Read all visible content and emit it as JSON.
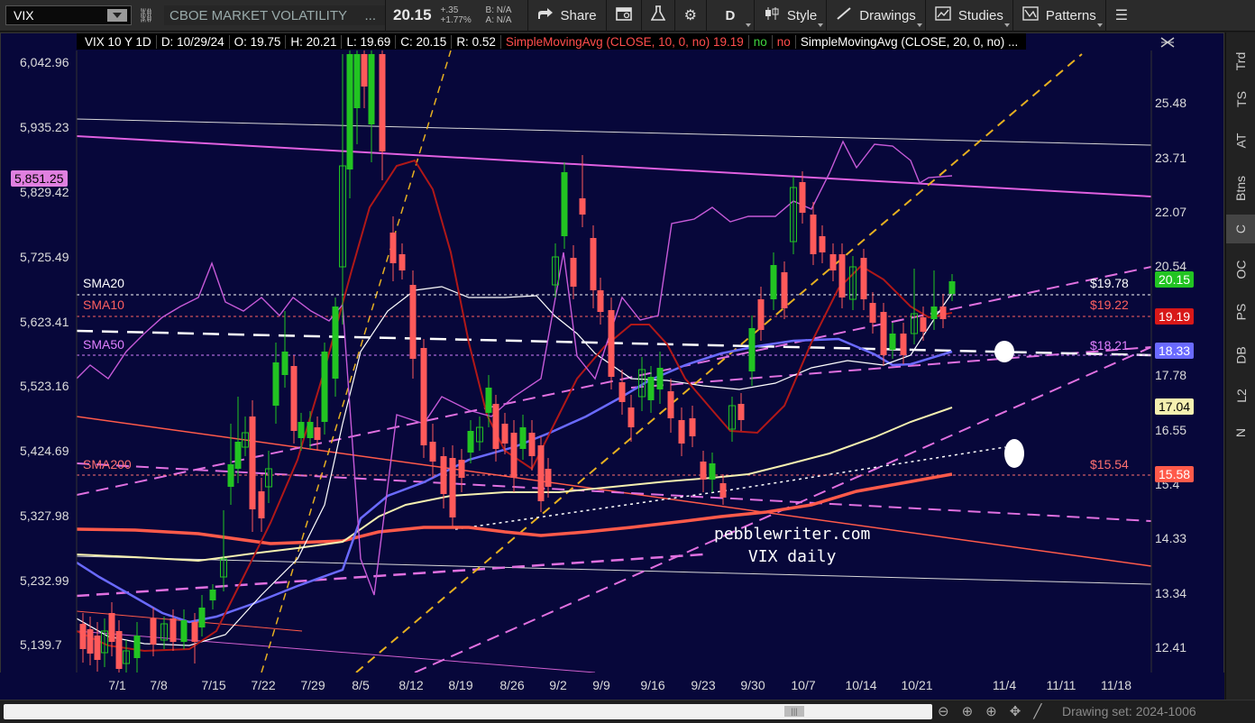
{
  "toolbar": {
    "symbol": "VIX",
    "description": "CBOE MARKET VOLATILITY",
    "description_more": "...",
    "last_price": "20.15",
    "net_change": "+.35",
    "pct_change": "+1.77%",
    "bid": "B: N/A",
    "ask": "A: N/A",
    "share_label": "Share",
    "aggregation": "D",
    "style_label": "Style",
    "drawings_label": "Drawings",
    "studies_label": "Studies",
    "patterns_label": "Patterns",
    "icons": [
      "link-icon",
      "share-icon",
      "calendar-icon",
      "flask-icon",
      "gear-icon",
      "candles-icon",
      "pencil-icon",
      "studies-icon",
      "patterns-icon",
      "menu-icon"
    ]
  },
  "info_bar": {
    "title": "VIX 10 Y 1D",
    "date": "D: 10/29/24",
    "open": "O: 19.75",
    "high": "H: 20.21",
    "low": "L: 19.69",
    "close": "C: 20.15",
    "range": "R: 0.52",
    "sma10_label": "SimpleMovingAvg (CLOSE, 10, 0, no)",
    "sma10_value": "19.19",
    "sma10_no1": "no",
    "sma10_no2": "no",
    "sma20_label": "SimpleMovingAvg (CLOSE, 20, 0, no)",
    "sma20_more": "..."
  },
  "left_axis": [
    "6,042.96",
    "5,935.23",
    "5,829.42",
    "5,725.49",
    "5,623.41",
    "5,523.16",
    "5,424.69",
    "5,327.98",
    "5,232.99",
    "5,139.7"
  ],
  "left_badge": "5,851.25",
  "right_axis": [
    "25.48",
    "23.71",
    "22.07",
    "20.54",
    "17.78",
    "16.55",
    "15.4",
    "14.33",
    "13.34",
    "12.41"
  ],
  "right_badges": {
    "last": "20.15",
    "sma10": "19.19",
    "sma50": "18.33",
    "yellow": "17.04",
    "sma200": "15.58"
  },
  "x_axis": [
    "7/1",
    "7/8",
    "7/15",
    "7/22",
    "7/29",
    "8/5",
    "8/12",
    "8/19",
    "8/26",
    "9/2",
    "9/9",
    "9/16",
    "9/23",
    "9/30",
    "10/7",
    "10/14",
    "10/21",
    "11/4",
    "11/11",
    "11/18"
  ],
  "chart_labels": {
    "sma20": "SMA20",
    "sma10": "SMA10",
    "sma50": "SMA50",
    "sma200": "SMA200",
    "sma20_price": "$19.78",
    "sma10_price": "$19.22",
    "sma50_price": "$18.21",
    "sma200_price": "$15.54"
  },
  "watermark": {
    "line1": "pebblewriter.com",
    "line2": "VIX daily"
  },
  "sidebar_tabs": [
    "Trd",
    "TS",
    "AT",
    "Btns",
    "C",
    "OC",
    "PS",
    "DB",
    "L2",
    "N"
  ],
  "bottom": {
    "drawing_set": "Drawing set: 2024-1006"
  },
  "colors": {
    "chart_bg": "#07073a",
    "bull": "#22c422",
    "bear": "#ff5a5a",
    "sma10": "#b01818",
    "sma20": "#ffffff",
    "sma50": "#6a6aff",
    "sma200": "#ff5a4a",
    "yellow_ma": "#f5f0b0",
    "spx": "#e060e0"
  }
}
